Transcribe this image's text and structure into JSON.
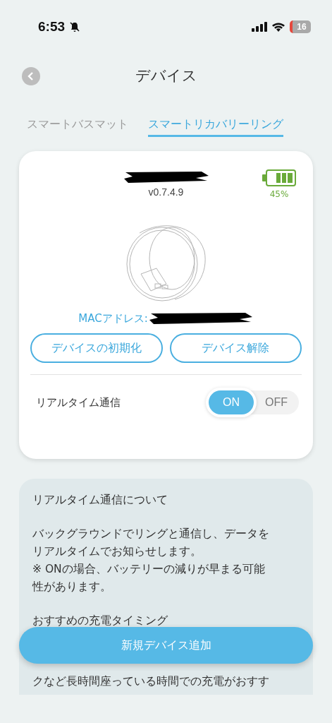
{
  "status_bar": {
    "time": "6:53",
    "battery": "16"
  },
  "header": {
    "title": "デバイス"
  },
  "tabs": [
    {
      "label": "スマートバスマット",
      "selected": false
    },
    {
      "label": "スマートリカバリーリング",
      "selected": true
    }
  ],
  "device": {
    "version": "v0.7.4.9",
    "battery": "45%",
    "mac_label": "MACアドレス:",
    "buttons": [
      "デバイスの初期化",
      "デバイス解除"
    ],
    "realtime": {
      "label": "リアルタイム通信",
      "options": [
        {
          "label": "ON",
          "selected": true
        },
        {
          "label": "OFF",
          "selected": false
        }
      ]
    }
  },
  "info": {
    "paragraphs": [
      [
        "リアルタイム通信について"
      ],
      [
        "バックグラウンドでリングと通信し、データを",
        "リアルタイムでお知らせします。",
        "※ ONの場合、バッテリーの減りが早まる可能",
        "性があります。"
      ],
      [
        "おすすめの充電タイミング"
      ]
    ],
    "tail": [
      "クなど長時間座っている時間での充電がおすす"
    ]
  },
  "add_button": "新規デバイス追加"
}
